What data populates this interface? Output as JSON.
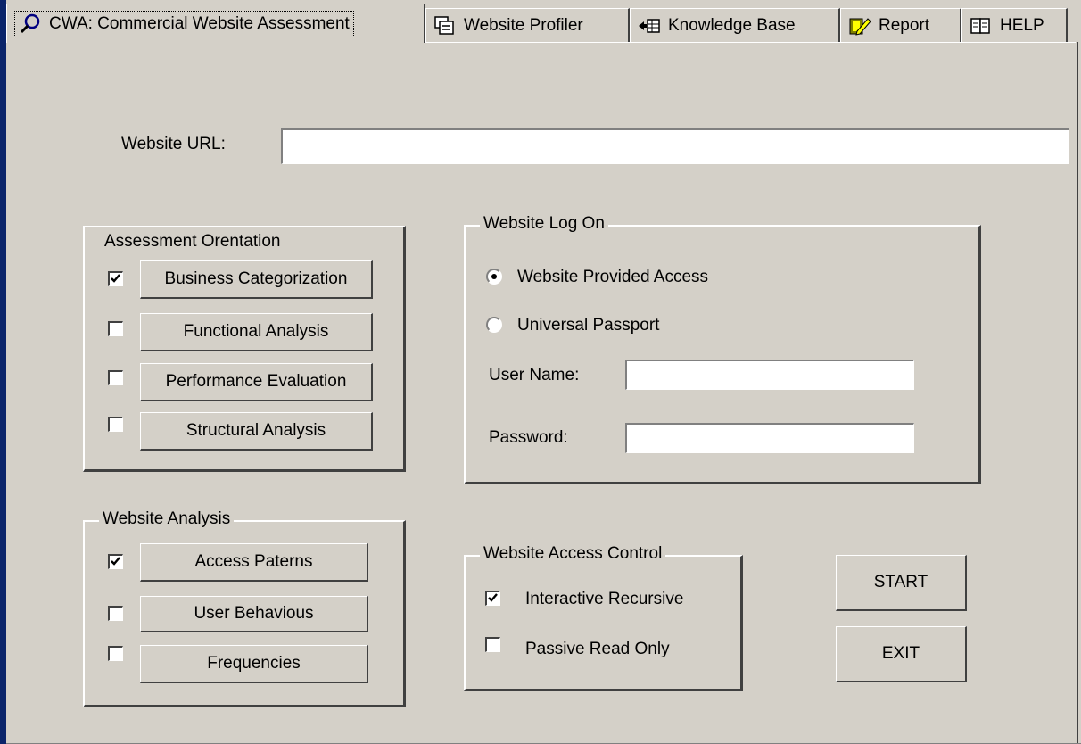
{
  "tabs": [
    {
      "label": "CWA: Commercial Website Assessment",
      "icon": "magnifier-icon",
      "active": true
    },
    {
      "label": "Website Profiler",
      "icon": "windows-icon",
      "active": false
    },
    {
      "label": "Knowledge Base",
      "icon": "arrow-table-icon",
      "active": false
    },
    {
      "label": "Report",
      "icon": "report-pencil-icon",
      "active": false
    },
    {
      "label": "HELP",
      "icon": "book-icon",
      "active": false
    }
  ],
  "url": {
    "label": "Website URL:",
    "value": ""
  },
  "assessment": {
    "title": "Assessment Orentation",
    "items": [
      {
        "label": "Business Categorization",
        "checked": true
      },
      {
        "label": "Functional Analysis",
        "checked": false
      },
      {
        "label": "Performance Evaluation",
        "checked": false
      },
      {
        "label": "Structural Analysis",
        "checked": false
      }
    ]
  },
  "logon": {
    "title": "Website Log On",
    "options": [
      {
        "label": "Website Provided Access",
        "selected": true
      },
      {
        "label": "Universal Passport",
        "selected": false
      }
    ],
    "username_label": "User Name:",
    "username_value": "",
    "password_label": "Password:",
    "password_value": ""
  },
  "analysis": {
    "title": "Website Analysis",
    "items": [
      {
        "label": "Access Paterns",
        "checked": true
      },
      {
        "label": "User Behavious",
        "checked": false
      },
      {
        "label": "Frequencies",
        "checked": false
      }
    ]
  },
  "access_control": {
    "title": "Website Access Control",
    "items": [
      {
        "label": "Interactive Recursive",
        "checked": true
      },
      {
        "label": "Passive Read Only",
        "checked": false
      }
    ]
  },
  "actions": {
    "start": "START",
    "exit": "EXIT"
  }
}
